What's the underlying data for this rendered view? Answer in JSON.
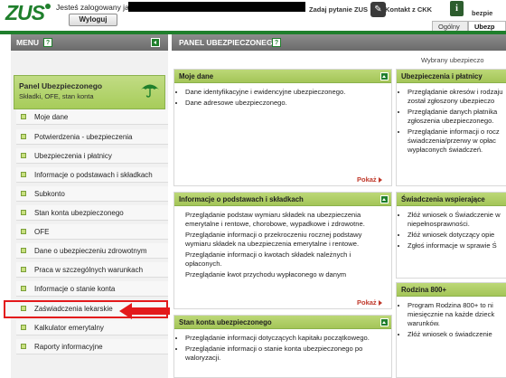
{
  "header": {
    "logo": "ZUS",
    "logged_in_label": "Jesteś zalogowany jako:",
    "logout_label": "Wyloguj",
    "ask_label": "Zadaj pytanie ZUS",
    "ckk_label": "Kontakt z CKK",
    "user_role_partial": "bezpie",
    "tabs": [
      {
        "label": "Ogólny"
      },
      {
        "label": "Ubezp"
      }
    ]
  },
  "menu": {
    "title": "MENU",
    "help": "?",
    "panel": {
      "title": "Panel Ubezpieczonego",
      "subtitle": "Składki, OFE, stan konta"
    },
    "items": [
      {
        "label": "Moje dane"
      },
      {
        "label": "Potwierdzenia - ubezpieczenia"
      },
      {
        "label": "Ubezpieczenia i płatnicy"
      },
      {
        "label": "Informacje o podstawach i składkach"
      },
      {
        "label": "Subkonto"
      },
      {
        "label": "Stan konta ubezpieczonego"
      },
      {
        "label": "OFE"
      },
      {
        "label": "Dane o ubezpieczeniu zdrowotnym"
      },
      {
        "label": "Praca w szczególnych warunkach"
      },
      {
        "label": "Informacje o stanie konta"
      },
      {
        "label": "Zaświadczenia lekarskie"
      },
      {
        "label": "Kalkulator emerytalny"
      },
      {
        "label": "Raporty informacyjne"
      }
    ]
  },
  "main": {
    "title": "PANEL UBEZPIECZONEGO",
    "help": "?",
    "wybrany": "Wybrany ubezpieczo",
    "pokaz": "Pokaż",
    "boxes": {
      "moje_dane": {
        "title": "Moje dane",
        "items": [
          "Dane identyfikacyjne i ewidencyjne ubezpieczonego.",
          "Dane adresowe ubezpieczonego."
        ]
      },
      "ubezpieczenia": {
        "title": "Ubezpieczenia i płatnicy",
        "items": [
          "Przeglądanie okresów i rodzaju został zgłoszony ubezpieczo",
          "Przeglądanie danych płatnika zgłoszenia ubezpieczonego.",
          "Przeglądanie informacji o rocz świadczenia/przerwy w opłac wypłaconych świadczeń."
        ]
      },
      "podstawy": {
        "title": "Informacje o podstawach i składkach",
        "items": [
          "Przeglądanie podstaw wymiaru składek na ubezpieczenia emerytalne i rentowe, chorobowe, wypadkowe i zdrowotne.",
          "Przeglądanie informacji o przekroczeniu rocznej podstawy wymiaru składek na ubezpieczenia emerytalne i rentowe.",
          "Przeglądanie informacji o kwotach składek należnych i opłaconych.",
          "Przeglądanie kwot przychodu wypłaconego w danym"
        ]
      },
      "swiadczenia": {
        "title": "Świadczenia wspierające",
        "items": [
          "Złóż wniosek o Świadczenie w niepełnosprawności.",
          "Złóż wniosek dotyczący opie",
          "Zgłoś informacje w sprawie Ś"
        ]
      },
      "rodzina": {
        "title": "Rodzina 800+",
        "items": [
          "Program Rodzina 800+ to ni miesięcznie na każde dzieck warunków.",
          "Złóż wniosek o świadczenie"
        ]
      },
      "stan_konta": {
        "title": "Stan konta ubezpieczonego",
        "items": [
          "Przeglądanie informacji dotyczących kapitału początkowego.",
          "Przeglądanie informacji o stanie konta ubezpieczonego po waloryzacji."
        ]
      }
    }
  },
  "colors": {
    "brand_green": "#1f7f2c",
    "box_header_green": "#a4c558",
    "annotation_red": "#e3191b",
    "link_red": "#c0392b"
  }
}
